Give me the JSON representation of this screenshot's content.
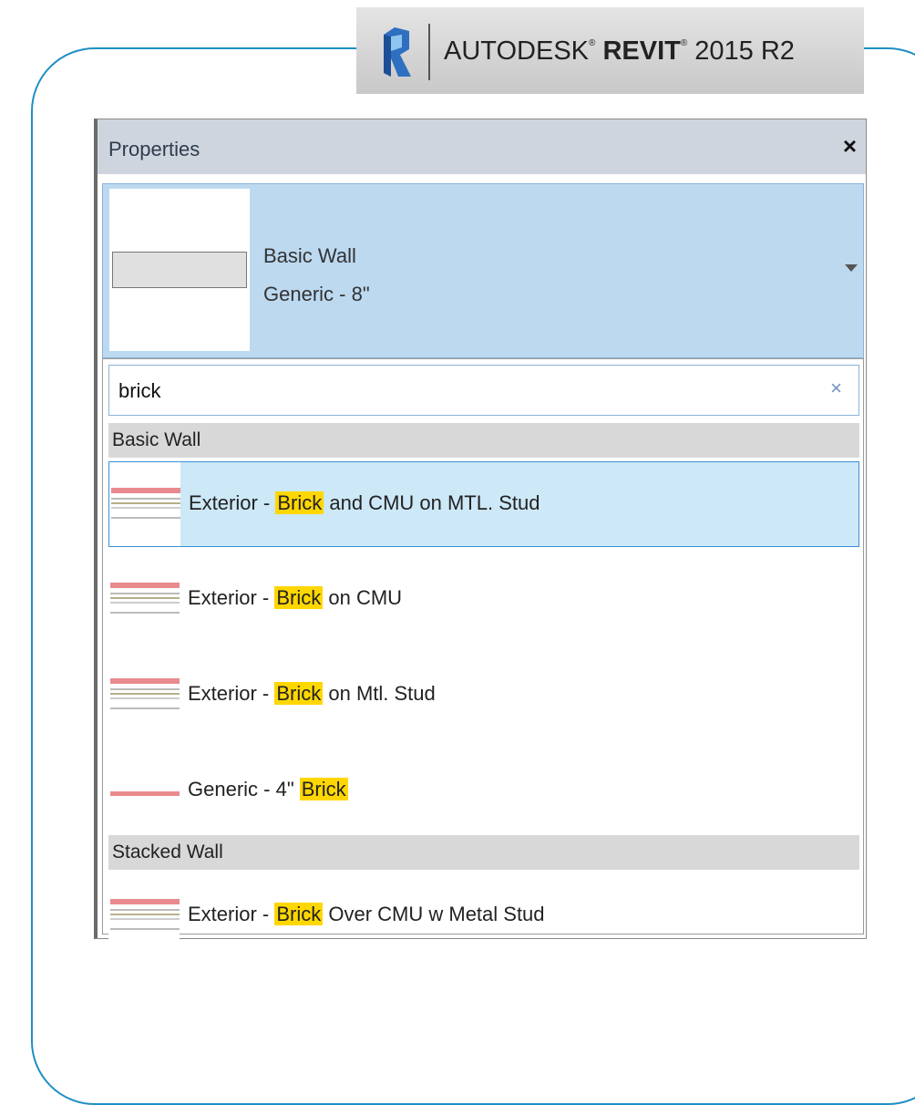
{
  "banner": {
    "brand": "AUTODESK",
    "product": "REVIT",
    "version": "2015 R2",
    "reg_mark": "®"
  },
  "panel": {
    "title": "Properties",
    "close_glyph": "×"
  },
  "type_selector": {
    "family": "Basic Wall",
    "type_name": "Generic - 8\""
  },
  "search": {
    "value": "brick",
    "clear_glyph": "×"
  },
  "groups": [
    {
      "name": "Basic Wall",
      "items": [
        {
          "prefix": "Exterior - ",
          "match": "Brick",
          "suffix": " and CMU on MTL. Stud",
          "selected": true,
          "icon": "wall-layers-icon"
        },
        {
          "prefix": "Exterior - ",
          "match": "Brick",
          "suffix": " on CMU",
          "selected": false,
          "icon": "wall-layers-icon"
        },
        {
          "prefix": "Exterior - ",
          "match": "Brick",
          "suffix": " on Mtl. Stud",
          "selected": false,
          "icon": "wall-layers-icon"
        },
        {
          "prefix": "Generic - 4\" ",
          "match": "Brick",
          "suffix": "",
          "selected": false,
          "icon": "wall-single-icon"
        }
      ]
    },
    {
      "name": "Stacked Wall",
      "items": [
        {
          "prefix": "Exterior - ",
          "match": "Brick",
          "suffix": " Over CMU w Metal Stud",
          "selected": false,
          "icon": "wall-layers-icon"
        }
      ]
    }
  ],
  "colors": {
    "frame": "#1f8fc4",
    "selector_bg": "#bcd9f0",
    "selected_bg": "#cde8f7",
    "highlight": "#ffd700",
    "brick_layer": "#e98a8f"
  }
}
